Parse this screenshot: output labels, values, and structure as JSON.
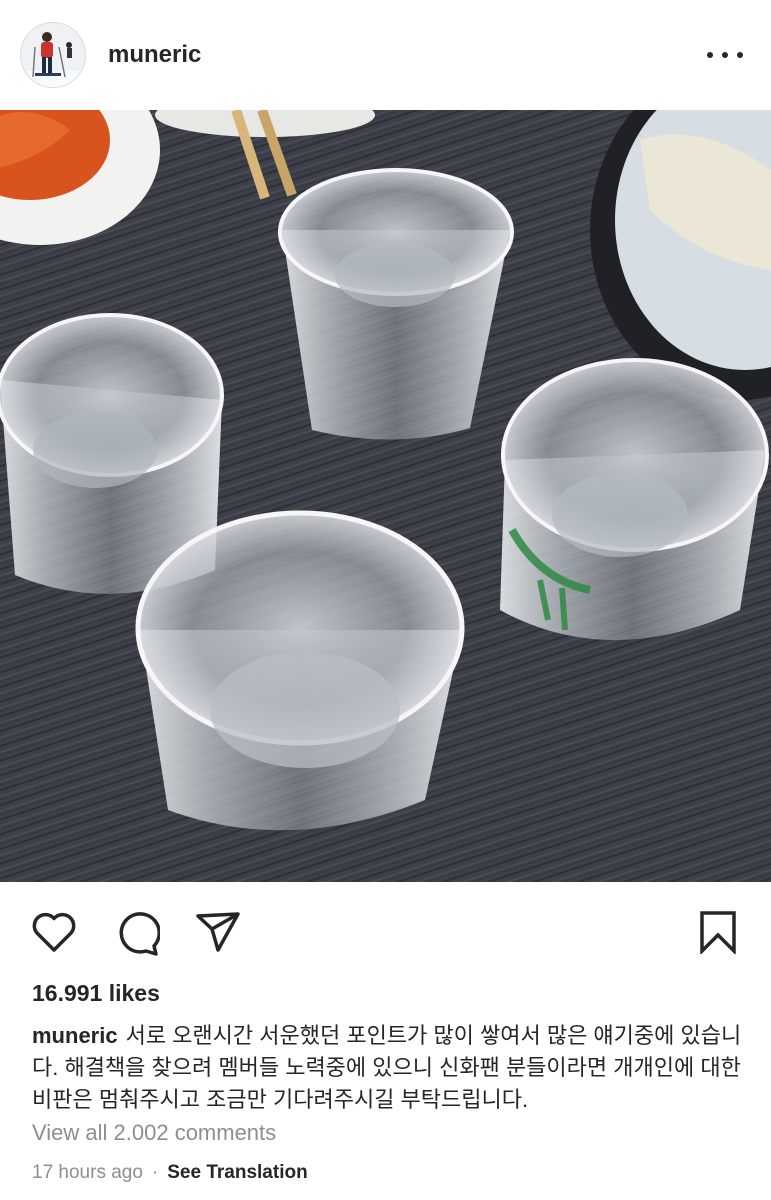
{
  "post": {
    "username": "muneric",
    "more_icon": "more-horizontal-icon"
  },
  "actions": {
    "like_icon": "heart-outline-icon",
    "comment_icon": "comment-bubble-icon",
    "share_icon": "paper-plane-icon",
    "save_icon": "bookmark-outline-icon"
  },
  "likes_text": "16.991 likes",
  "caption": {
    "username": "muneric",
    "text": "서로 오랜시간 서운했던 포인트가 많이 쌓여서 많은 얘기중에 있습니다. 해결책을 찾으려 멤버들 노력중에 있으니 신화팬 분들이라면 개개인에 대한 비판은 멈춰주시고 조금만 기다려주시길 부탁드립니다."
  },
  "comments_link": "View all 2.002 comments",
  "timestamp": "17 hours ago",
  "separator": "·",
  "see_translation": "See Translation"
}
